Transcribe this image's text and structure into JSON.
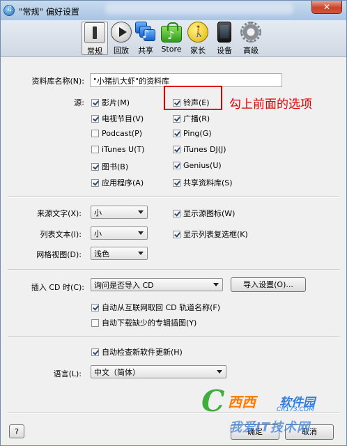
{
  "window": {
    "title": "\"常规\" 偏好设置",
    "close_glyph": "✕"
  },
  "toolbar": {
    "items": [
      {
        "label": "常规",
        "icon": "general-icon",
        "active": true
      },
      {
        "label": "回放",
        "icon": "playback-icon"
      },
      {
        "label": "共享",
        "icon": "sharing-icon"
      },
      {
        "label": "Store",
        "icon": "store-icon"
      },
      {
        "label": "家长",
        "icon": "parental-icon"
      },
      {
        "label": "设备",
        "icon": "device-icon"
      },
      {
        "label": "高级",
        "icon": "gear-icon"
      }
    ]
  },
  "library": {
    "label": "资料库名称(N):",
    "value": "\"小猪扒大虾\"的资料库"
  },
  "sources": {
    "label": "源:",
    "left": [
      {
        "label": "影片(M)",
        "checked": true
      },
      {
        "label": "电视节目(V)",
        "checked": true
      },
      {
        "label": "Podcast(P)",
        "checked": false
      },
      {
        "label": "iTunes U(T)",
        "checked": false
      },
      {
        "label": "图书(B)",
        "checked": true
      },
      {
        "label": "应用程序(A)",
        "checked": true
      }
    ],
    "right": [
      {
        "label": "铃声(E)",
        "checked": true
      },
      {
        "label": "广播(R)",
        "checked": true
      },
      {
        "label": "Ping(G)",
        "checked": true
      },
      {
        "label": "iTunes DJ(J)",
        "checked": true
      },
      {
        "label": "Genius(U)",
        "checked": true
      },
      {
        "label": "共享资料库(S)",
        "checked": true
      }
    ]
  },
  "annotation": {
    "text": "勾上前面的选项",
    "color": "#e00000"
  },
  "text_opts": {
    "source_text": {
      "label": "来源文字(X):",
      "value": "小"
    },
    "list_text": {
      "label": "列表文本(I):",
      "value": "小"
    },
    "grid_view": {
      "label": "网格视图(D):",
      "value": "浅色"
    },
    "show_source_icons": {
      "label": "显示源图标(W)",
      "checked": true
    },
    "show_list_checkboxes": {
      "label": "显示列表复选框(K)",
      "checked": true
    }
  },
  "cd": {
    "label": "插入 CD 时(C):",
    "value": "询问是否导入 CD",
    "import_button": "导入设置(O)...",
    "auto_names": {
      "label": "自动从互联网取回 CD 轨道名称(F)",
      "checked": true
    },
    "auto_artwork": {
      "label": "自动下载缺少的专辑插图(Y)",
      "checked": false
    }
  },
  "update": {
    "label": "自动检查新软件更新(H)",
    "checked": true
  },
  "language": {
    "label": "语言(L):",
    "value": "中文（简体）"
  },
  "footer": {
    "help": "?",
    "ok": "确定",
    "cancel": "取消"
  },
  "watermark": {
    "c": "C",
    "brand": "西西",
    "brand2": "软件园",
    "domain": "CR173.COM",
    "tagline": "我爱IT技术网"
  }
}
